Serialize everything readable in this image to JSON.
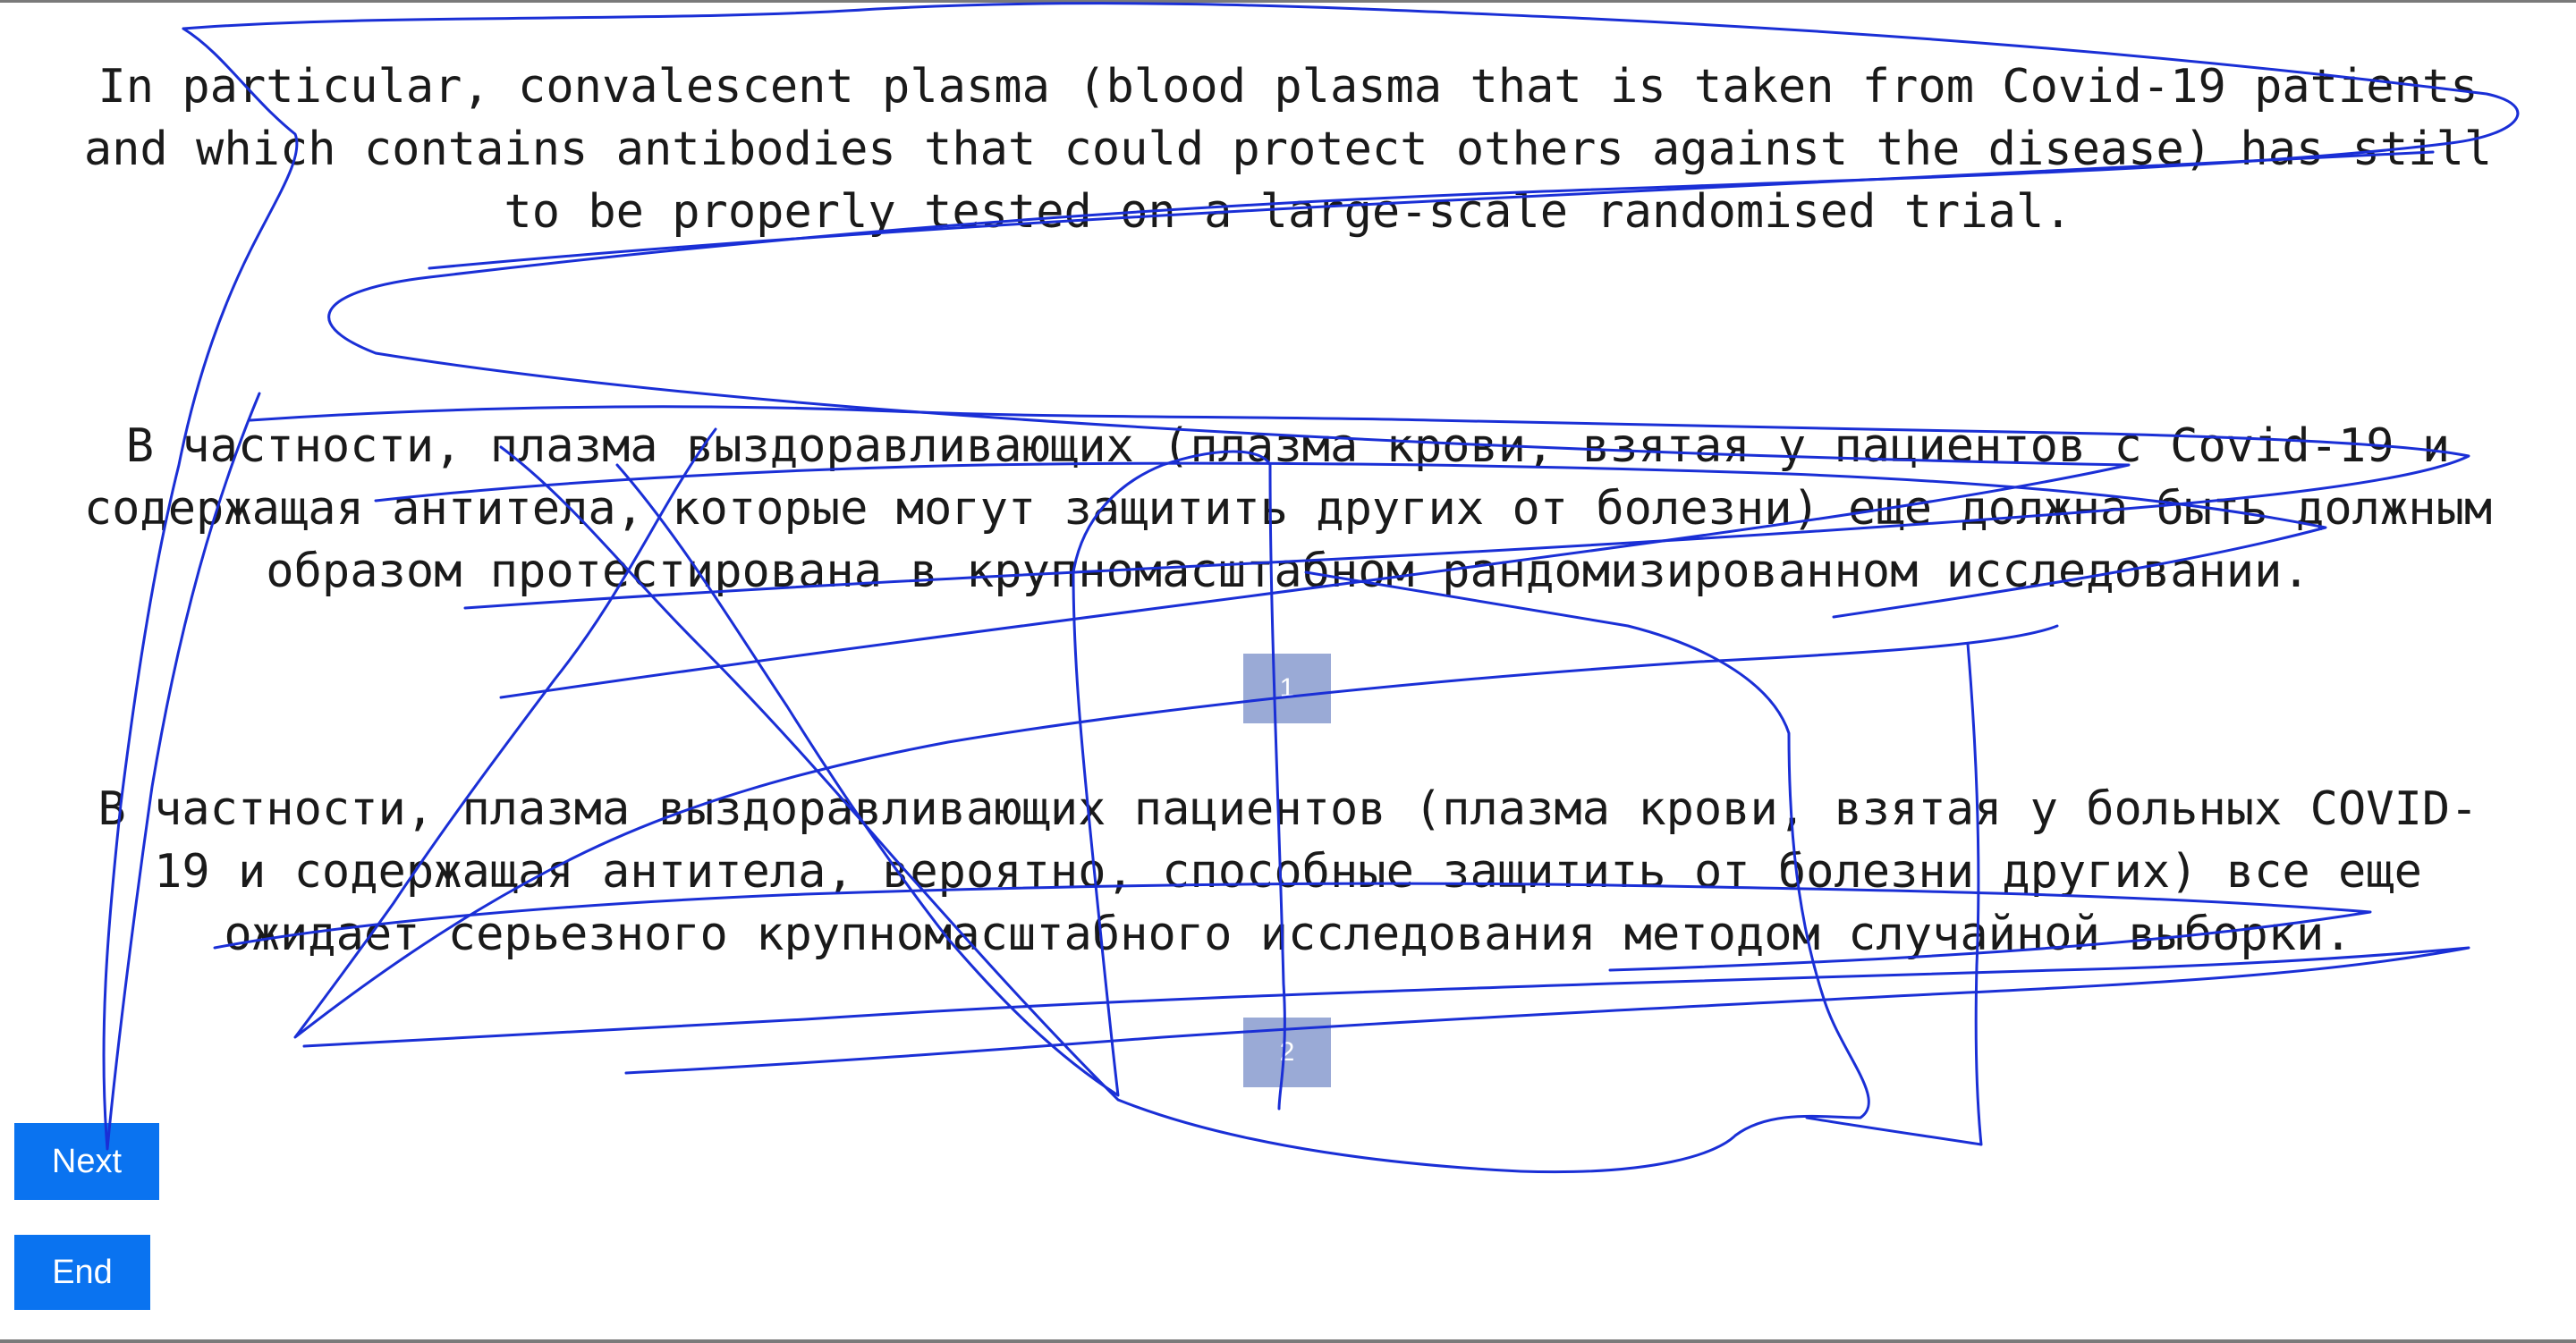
{
  "source_text": {
    "lines": [
      "In particular, convalescent plasma (blood plasma that is taken from Covid-19 patients",
      "and which contains antibodies that could protect others against the disease) has still",
      "to be properly tested on a large-scale randomised trial."
    ]
  },
  "reference_translation": {
    "lines": [
      "В частности, плазма выздоравливающих (плазма крови, взятая у пациентов с Covid-19 и",
      "содержащая антитела, которые могут защитить других от болезни) еще должна быть должным",
      "образом протестирована в крупномасштабном рандомизированном исследовании."
    ]
  },
  "candidate_translation": {
    "lines": [
      "В частности, плазма выздоравливающих пациентов (плазма крови, взятая у больных COVID-",
      "19 и содержащая антитела, вероятно, способные защитить от болезни других) все еще",
      "ожидает серьезного крупномасштабного исследования методом случайной выборки."
    ]
  },
  "rating_boxes": [
    {
      "label": "1"
    },
    {
      "label": "2"
    }
  ],
  "buttons": {
    "next_label": "Next",
    "end_label": "End"
  },
  "colors": {
    "button_blue": "#0a73f0",
    "rating_box": "#9aaad6",
    "pen_stroke": "#1a2fd6"
  }
}
